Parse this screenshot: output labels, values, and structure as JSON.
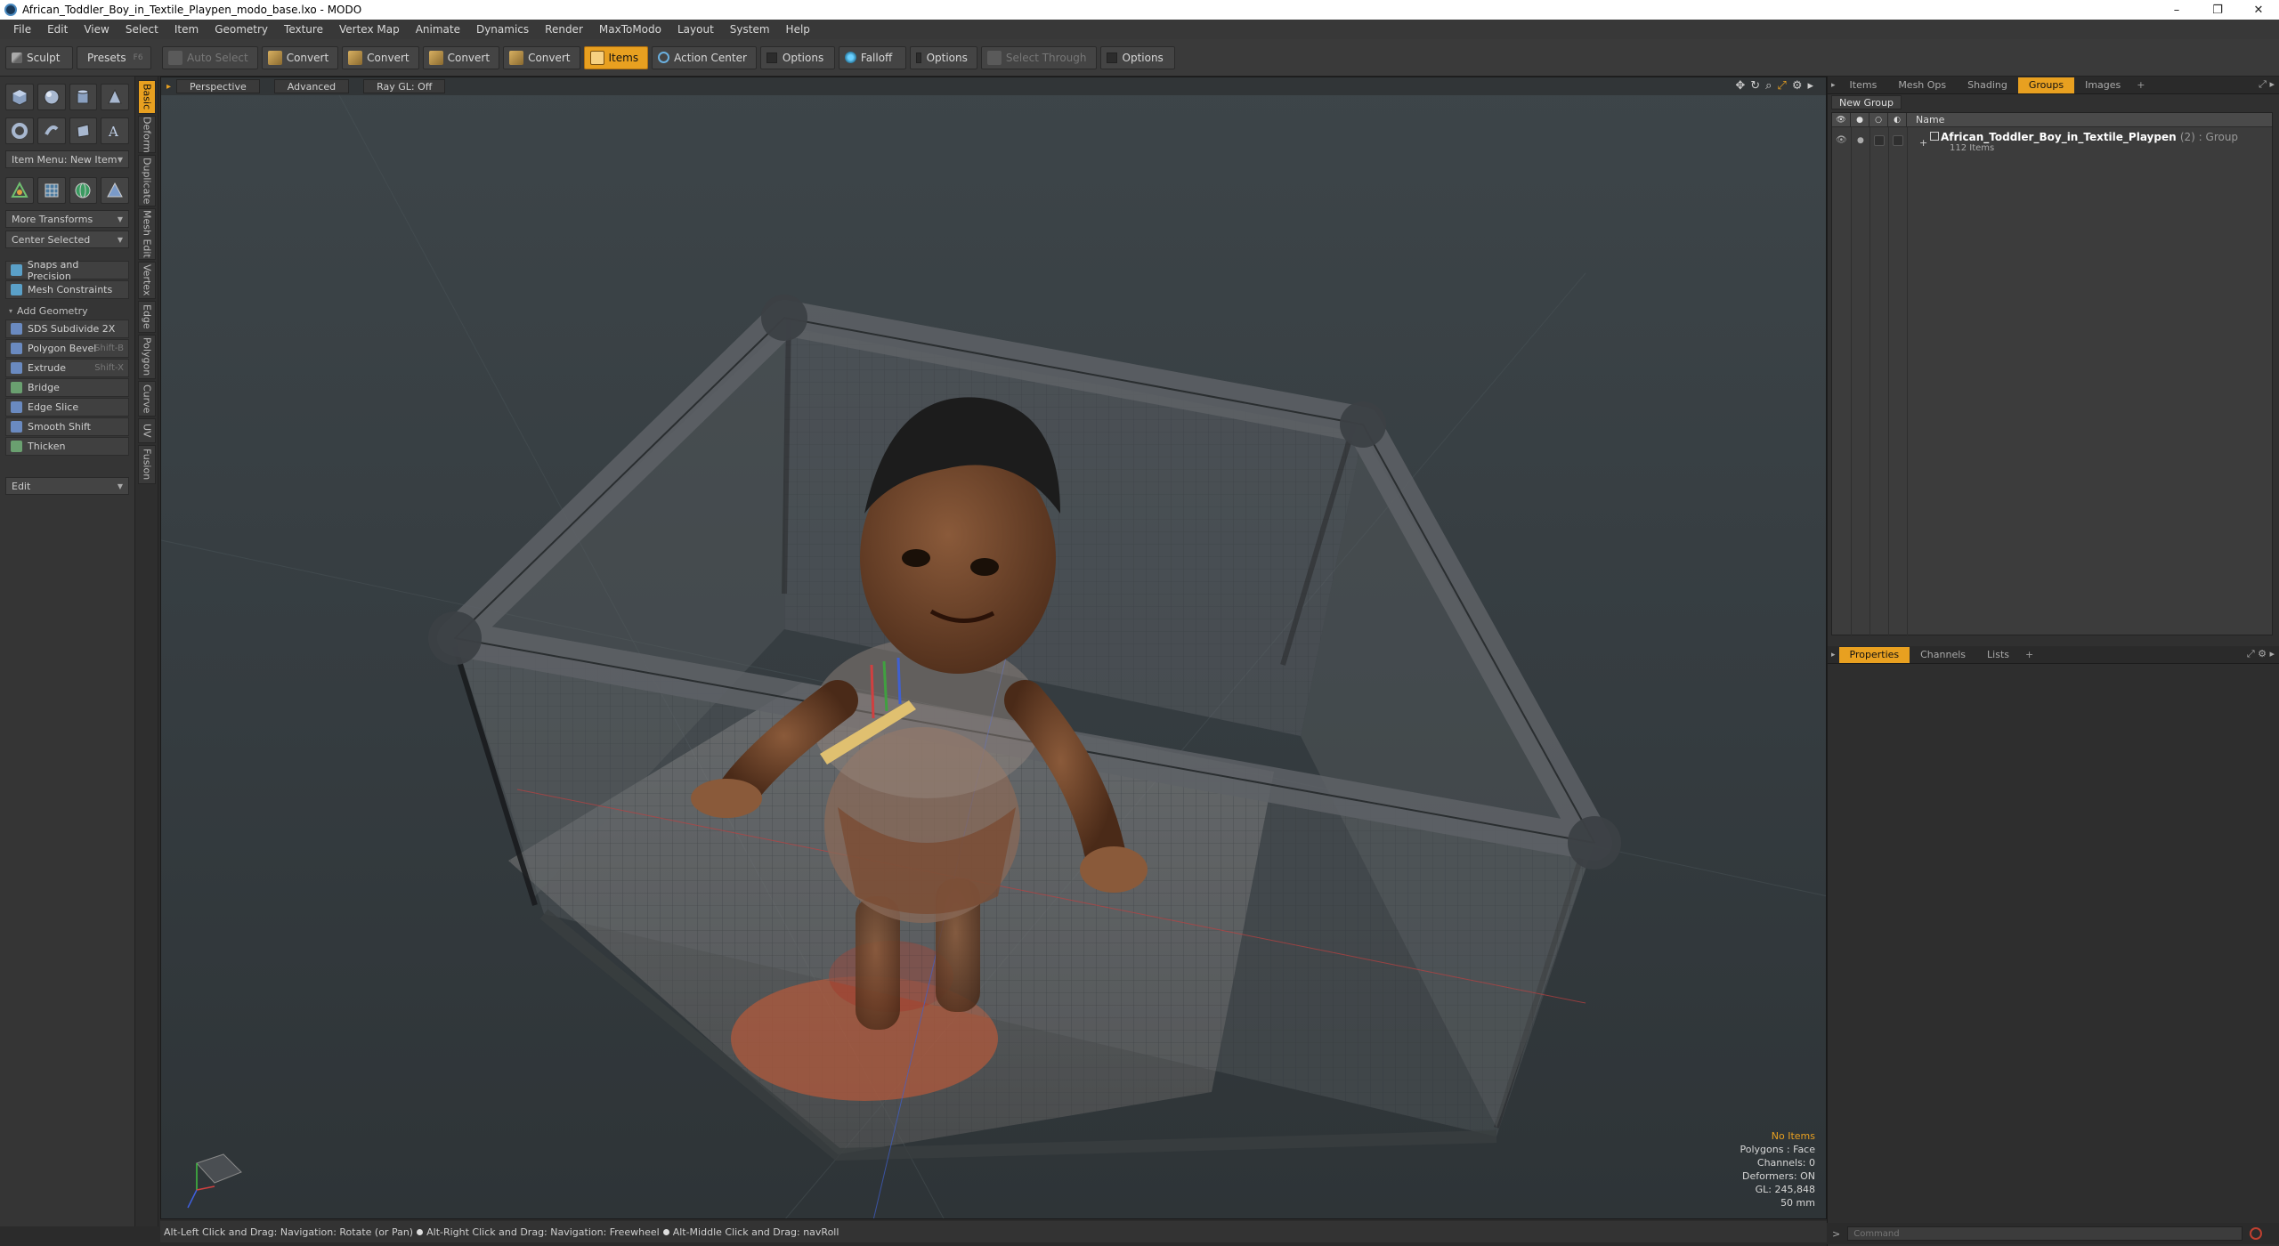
{
  "window": {
    "title": "African_Toddler_Boy_in_Textile_Playpen_modo_base.lxo - MODO",
    "controls": [
      "–",
      "❐",
      "✕"
    ]
  },
  "menu": [
    "File",
    "Edit",
    "View",
    "Select",
    "Item",
    "Geometry",
    "Texture",
    "Vertex Map",
    "Animate",
    "Dynamics",
    "Render",
    "MaxToModo",
    "Layout",
    "System",
    "Help"
  ],
  "toolbar": {
    "sculpt": "Sculpt",
    "presets": "Presets",
    "auto_select": "Auto Select",
    "convert": "Convert",
    "items": "Items",
    "action_center": "Action Center",
    "options": "Options",
    "falloff": "Falloff",
    "select_through": "Select Through"
  },
  "left_panel": {
    "item_menu": "Item Menu: New Item",
    "more_transforms": "More Transforms",
    "center_selected": "Center Selected",
    "snaps": "Snaps and Precision",
    "mesh_constraints": "Mesh Constraints",
    "add_geometry": "Add Geometry",
    "tools": [
      {
        "label": "SDS Subdivide 2X",
        "shortcut": ""
      },
      {
        "label": "Polygon Bevel",
        "shortcut": "Shift-B"
      },
      {
        "label": "Extrude",
        "shortcut": "Shift-X"
      },
      {
        "label": "Bridge",
        "shortcut": ""
      },
      {
        "label": "Edge Slice",
        "shortcut": ""
      },
      {
        "label": "Smooth Shift",
        "shortcut": ""
      },
      {
        "label": "Thicken",
        "shortcut": ""
      }
    ],
    "edit": "Edit"
  },
  "vertical_tabs": [
    "Basic",
    "Deform",
    "Duplicate",
    "Mesh Edit",
    "Vertex",
    "Edge",
    "Polygon",
    "Curve",
    "UV",
    "Fusion"
  ],
  "viewport": {
    "tabs": [
      "Perspective",
      "Advanced",
      "Ray GL: Off"
    ],
    "info": {
      "selection": "No Items",
      "polygons": "Polygons : Face",
      "channels": "Channels: 0",
      "deformers": "Deformers: ON",
      "gl": "GL: 245,848",
      "lens": "50 mm"
    }
  },
  "status_bar": {
    "hint1": "Alt-Left Click and Drag: Navigation: Rotate (or Pan)",
    "hint2": "Alt-Right Click and Drag: Navigation: Freewheel",
    "hint3": "Alt-Middle Click and Drag: navRoll"
  },
  "groups_panel": {
    "tabs": [
      "Items",
      "Mesh Ops",
      "Shading",
      "Groups",
      "Images"
    ],
    "active_tab": "Groups",
    "new_group": "New Group",
    "column_name": "Name",
    "group": {
      "name": "African_Toddler_Boy_in_Textile_Playpen",
      "suffix": "(2) : Group",
      "count": "112 Items"
    }
  },
  "properties_panel": {
    "tabs": [
      "Properties",
      "Channels",
      "Lists"
    ],
    "active_tab": "Properties"
  },
  "command": {
    "prompt": ">",
    "placeholder": "Command"
  },
  "colors": {
    "accent": "#e8a020",
    "viewport_bg": "#3a4245"
  }
}
